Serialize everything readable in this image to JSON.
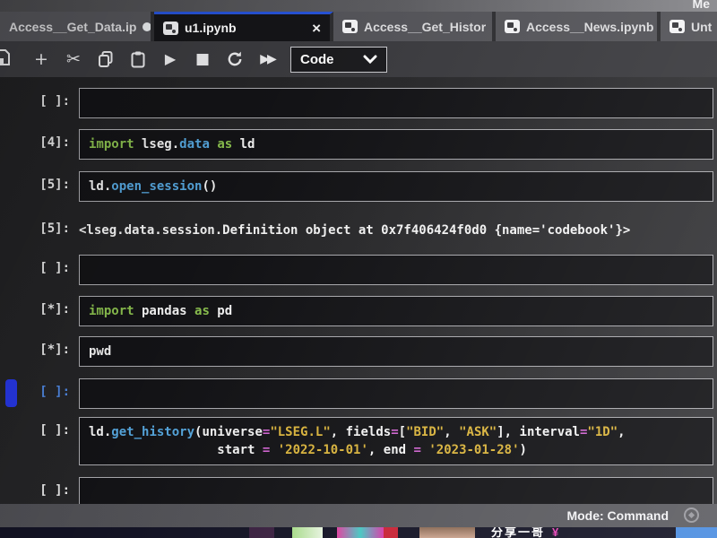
{
  "window": {
    "overflow_text": "Me"
  },
  "tabs": [
    {
      "label": "Access__Get_Data.ip",
      "dirty": "●"
    },
    {
      "label": "u1.ipynb",
      "close": "×"
    },
    {
      "label": "Access__Get_Histor",
      "dirty": "●"
    },
    {
      "label": "Access__News.ipynb",
      "dirty": "●"
    },
    {
      "label": "Unt"
    }
  ],
  "toolbar": {
    "cell_type": "Code"
  },
  "colors": {
    "accent_blue": "#2753d8",
    "selected_cell_blue": "#2636e2",
    "keyword_green": "#8abf4e",
    "function_blue": "#55a5dc",
    "string_yellow": "#d9b33c",
    "operator_magenta": "#cf63cf"
  },
  "cells": [
    {
      "prompt": "[ ]:",
      "lines": []
    },
    {
      "prompt": "[4]:",
      "lines": [
        [
          [
            "import",
            "kw"
          ],
          [
            " lseg.",
            "pl"
          ],
          [
            "data",
            "fn"
          ],
          [
            " ",
            "pl"
          ],
          [
            "as",
            "kw"
          ],
          [
            " ld",
            "pl"
          ]
        ]
      ]
    },
    {
      "prompt": "[5]:",
      "lines": [
        [
          [
            "ld.",
            "pl"
          ],
          [
            "open_session",
            "fn"
          ],
          [
            "()",
            "pl"
          ]
        ]
      ]
    },
    {
      "prompt": "[5]:",
      "output": "<lseg.data.session.Definition object at 0x7f406424f0d0 {name='codebook'}>"
    },
    {
      "prompt": "[ ]:",
      "lines": []
    },
    {
      "prompt": "[*]:",
      "lines": [
        [
          [
            "import",
            "kw"
          ],
          [
            " pandas ",
            "pl"
          ],
          [
            "as",
            "kw"
          ],
          [
            " pd",
            "pl"
          ]
        ]
      ]
    },
    {
      "prompt": "[*]:",
      "lines": [
        [
          [
            "pwd",
            "pl"
          ]
        ]
      ]
    },
    {
      "prompt": "[ ]:",
      "selected": true,
      "lines": []
    },
    {
      "prompt": "[ ]:",
      "lines": [
        [
          [
            "ld.",
            "pl"
          ],
          [
            "get_history",
            "fn"
          ],
          [
            "(",
            "pl"
          ],
          [
            "universe",
            "pl"
          ],
          [
            "=",
            "op"
          ],
          [
            "\"LSEG.L\"",
            "str"
          ],
          [
            ", ",
            "pl"
          ],
          [
            "fields",
            "pl"
          ],
          [
            "=",
            "op"
          ],
          [
            "[",
            "pl"
          ],
          [
            "\"BID\"",
            "str"
          ],
          [
            ", ",
            "pl"
          ],
          [
            "\"ASK\"",
            "str"
          ],
          [
            "], ",
            "pl"
          ],
          [
            "interval",
            "pl"
          ],
          [
            "=",
            "op"
          ],
          [
            "\"1D\"",
            "str"
          ],
          [
            ",",
            "pl"
          ]
        ],
        [
          [
            "                 ",
            "pl"
          ],
          [
            "start ",
            "pl"
          ],
          [
            "=",
            "op"
          ],
          [
            " ",
            "pl"
          ],
          [
            "'2022-10-01'",
            "str"
          ],
          [
            ", ",
            "pl"
          ],
          [
            "end ",
            "pl"
          ],
          [
            "=",
            "op"
          ],
          [
            " ",
            "pl"
          ],
          [
            "'2023-01-28'",
            "str"
          ],
          [
            ")",
            "pl"
          ]
        ]
      ]
    },
    {
      "prompt": "[ ]:",
      "lines": []
    }
  ],
  "statusbar": {
    "mode": "Mode: Command"
  },
  "bottom_overlay": {
    "text": "分享一哥",
    "symbol": "¥"
  }
}
